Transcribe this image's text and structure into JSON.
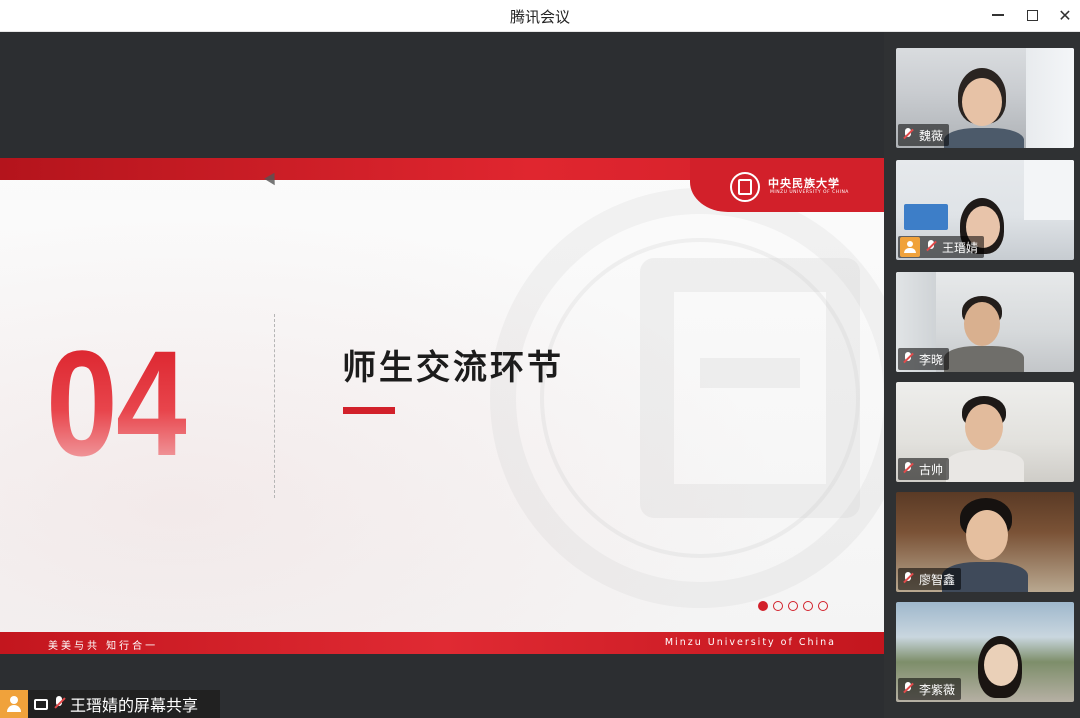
{
  "window": {
    "title": "腾讯会议"
  },
  "slide": {
    "number": "04",
    "title": "师生交流环节",
    "logo_cn": "中央民族大学",
    "logo_en": "MINZU UNIVERSITY OF CHINA",
    "motto": "美美与共  知行合一",
    "university_en": "Minzu University of China",
    "pager": {
      "total": 5,
      "active_index": 0
    }
  },
  "share": {
    "label": "王瑨婧的屏幕共享"
  },
  "participants": [
    {
      "name": "魏薇",
      "has_avatar_badge": false
    },
    {
      "name": "王瑨婧",
      "has_avatar_badge": true
    },
    {
      "name": "李晓",
      "has_avatar_badge": false
    },
    {
      "name": "古帅",
      "has_avatar_badge": false
    },
    {
      "name": "廖智鑫",
      "has_avatar_badge": false
    },
    {
      "name": "李紫薇",
      "has_avatar_badge": false
    }
  ],
  "colors": {
    "brand_red": "#d2202a",
    "panel_bg": "#2f3133",
    "stage_bg": "#2c2e31",
    "badge_orange": "#f0a23b"
  }
}
